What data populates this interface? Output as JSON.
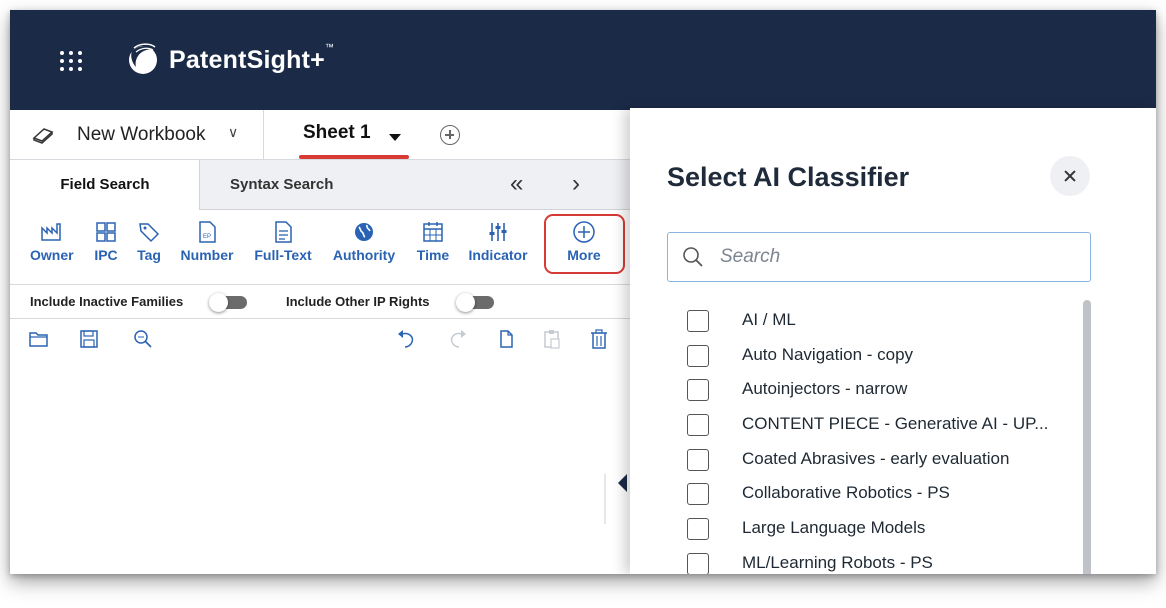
{
  "app": {
    "name": "PatentSight+",
    "trademark": "™"
  },
  "workbook": {
    "name": "New Workbook",
    "active_sheet": "Sheet 1"
  },
  "search_tabs": {
    "field": "Field Search",
    "syntax": "Syntax Search"
  },
  "fields": [
    {
      "label": "Owner",
      "icon": "owner-icon"
    },
    {
      "label": "IPC",
      "icon": "ipc-icon"
    },
    {
      "label": "Tag",
      "icon": "tag-icon"
    },
    {
      "label": "Number",
      "icon": "number-icon"
    },
    {
      "label": "Full-Text",
      "icon": "fulltext-icon"
    },
    {
      "label": "Authority",
      "icon": "globe-icon"
    },
    {
      "label": "Time",
      "icon": "calendar-icon"
    },
    {
      "label": "Indicator",
      "icon": "sliders-icon"
    },
    {
      "label": "More",
      "icon": "plus-circle-icon"
    }
  ],
  "toggles": {
    "inactive_families": "Include Inactive Families",
    "other_ip_rights": "Include Other IP Rights"
  },
  "drawer": {
    "title": "Select AI Classifier",
    "search_placeholder": "Search",
    "items": [
      "AI / ML",
      "Auto Navigation - copy",
      "Autoinjectors - narrow",
      "CONTENT PIECE - Generative AI - UP...",
      "Coated Abrasives - early evaluation",
      "Collaborative Robotics - PS",
      "Large Language Models",
      "ML/Learning Robots - PS"
    ]
  },
  "colors": {
    "appbar": "#1b2a47",
    "accent_blue": "#2a63b3",
    "highlight_red": "#d63a35"
  }
}
